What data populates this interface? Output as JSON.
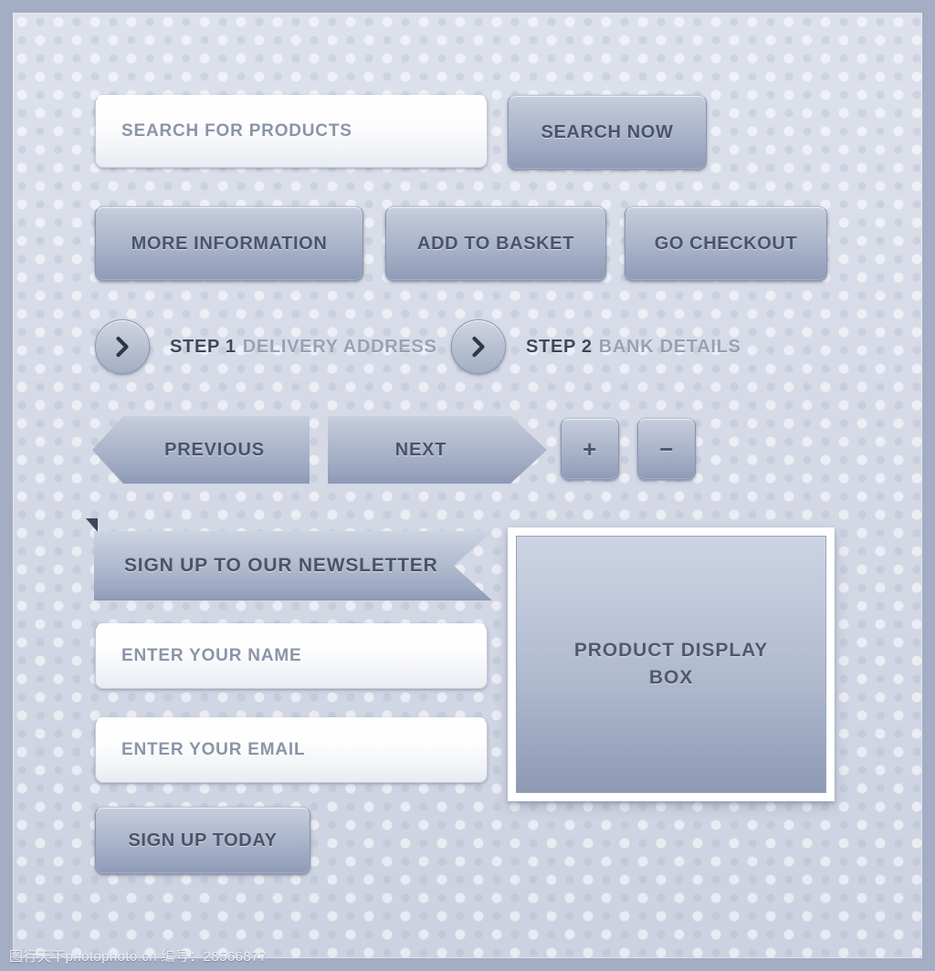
{
  "search": {
    "placeholder": "SEARCH FOR PRODUCTS",
    "button_label": "SEARCH NOW"
  },
  "actions": {
    "more_information": "MORE INFORMATION",
    "add_to_basket": "ADD TO BASKET",
    "go_checkout": "GO CHECKOUT"
  },
  "steps": [
    {
      "number": "STEP 1",
      "label": "DELIVERY ADDRESS",
      "icon": "chevron-right-icon"
    },
    {
      "number": "STEP 2",
      "label": "BANK DETAILS",
      "icon": "chevron-right-icon"
    }
  ],
  "nav": {
    "previous": "PREVIOUS",
    "next": "NEXT",
    "plus": "+",
    "minus": "−"
  },
  "newsletter": {
    "ribbon_label": "SIGN UP TO OUR NEWSLETTER",
    "name_placeholder": "ENTER YOUR NAME",
    "email_placeholder": "ENTER YOUR EMAIL",
    "submit_label": "SIGN UP TODAY"
  },
  "product": {
    "label": "PRODUCT DISPLAY BOX"
  },
  "watermark": "图行天下photophoto.cn  编号：28566877",
  "colors": {
    "page_border": "#a3adc4",
    "panel_bg": "#d6dae6",
    "button_top": "#c7cedd",
    "button_bottom": "#8e9ab6",
    "button_text": "#4a5369",
    "placeholder_text": "#8b94a8",
    "step_number_text": "#3f4759",
    "step_label_text": "#98a1b5",
    "frame_white": "#ffffff"
  }
}
